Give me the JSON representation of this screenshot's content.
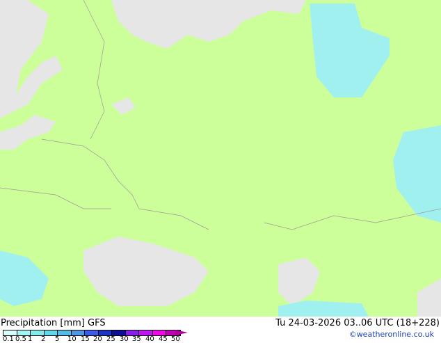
{
  "legend": {
    "title": "Precipitation [mm]",
    "model": "GFS",
    "ticks": [
      "0.1",
      "0.5",
      "1",
      "2",
      "5",
      "10",
      "15",
      "20",
      "25",
      "30",
      "35",
      "40",
      "45",
      "50"
    ],
    "colors": [
      "#d6fcfc",
      "#a0f6f6",
      "#80ecec",
      "#60d8ec",
      "#50bce8",
      "#4c98e4",
      "#3a5ce8",
      "#1c34c4",
      "#0c1096",
      "#8a1cf0",
      "#c014f0",
      "#f008e8",
      "#c000b8",
      "#9a0090"
    ]
  },
  "valid_time": "Tu 24-03-2026 03..06 UTC (18+228)",
  "credit": "©weatheronline.co.uk",
  "colors": {
    "land": "#ccff99",
    "sea": "#e6e6e6",
    "precip": "#a0f0f0"
  }
}
